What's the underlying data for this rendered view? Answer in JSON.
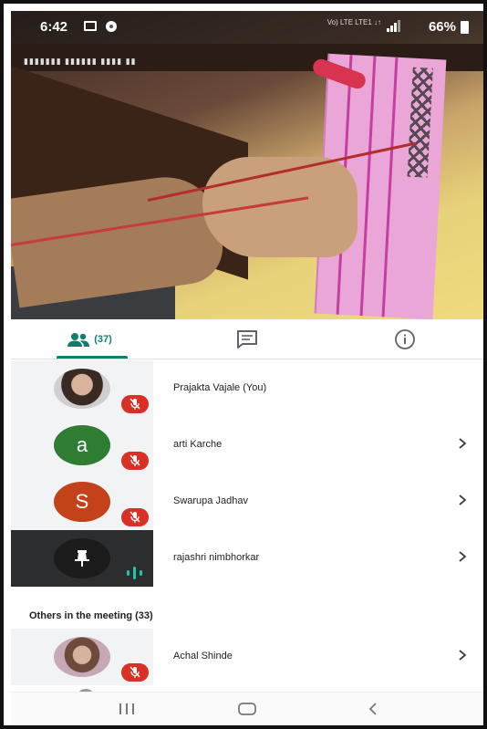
{
  "status_bar": {
    "time": "6:42",
    "network": "Vo) LTE LTE1 ↓↑",
    "battery": "66%",
    "icons": [
      "gallery-icon",
      "location-pin-icon",
      "signal-icon",
      "battery-icon"
    ]
  },
  "tabs": {
    "people_count": "(37)",
    "icons": [
      "people-icon",
      "chat-icon",
      "info-icon"
    ],
    "accent_color": "#137c6c"
  },
  "participants": [
    {
      "name": "Prajakta Vajale (You)",
      "avatar": "photo",
      "status": "muted"
    },
    {
      "name": "arti Karche",
      "avatar_letter": "a",
      "avatar_color": "#2e7d32",
      "status": "muted"
    },
    {
      "name": "Swarupa Jadhav",
      "avatar_letter": "S",
      "avatar_color": "#c4421a",
      "status": "muted"
    },
    {
      "name": "rajashri nimbhorkar",
      "avatar": "pin-icon",
      "status": "speaking"
    }
  ],
  "others_section": {
    "label": "Others in the meeting (33)",
    "items": [
      {
        "name": "Achal Shinde",
        "avatar": "photo",
        "status": "muted"
      }
    ]
  },
  "colors": {
    "mute_badge": "#d93025",
    "speaking_indicator": "#1ec6b0"
  }
}
